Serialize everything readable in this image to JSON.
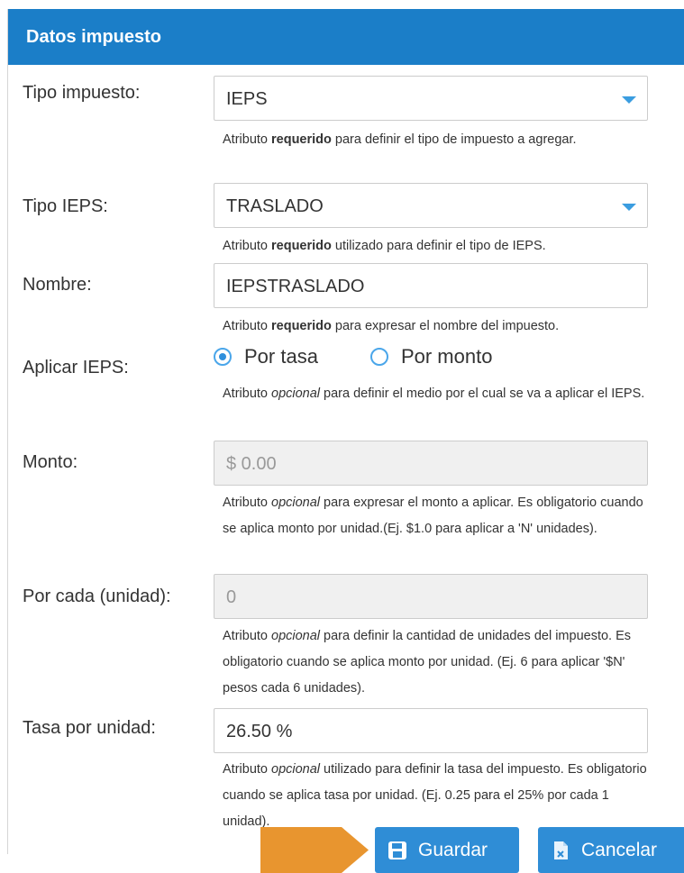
{
  "panel": {
    "title": "Datos impuesto"
  },
  "fields": {
    "tipo_impuesto": {
      "label": "Tipo impuesto:",
      "value": "IEPS",
      "help_pre": "Atributo ",
      "help_strong": "requerido",
      "help_post": " para definir el tipo de impuesto a agregar."
    },
    "tipo_ieps": {
      "label": "Tipo IEPS:",
      "value": "TRASLADO",
      "help_pre": "Atributo ",
      "help_strong": "requerido",
      "help_post": " utilizado para definir el tipo de IEPS."
    },
    "nombre": {
      "label": "Nombre:",
      "value": "IEPSTRASLADO",
      "help_pre": "Atributo ",
      "help_strong": "requerido",
      "help_post": " para expresar el nombre del impuesto."
    },
    "aplicar_ieps": {
      "label": "Aplicar IEPS:",
      "option1": "Por tasa",
      "option2": "Por monto",
      "selected": "Por tasa",
      "help_pre": "Atributo ",
      "help_em": "opcional",
      "help_post": " para definir el medio por el cual se va a aplicar el IEPS."
    },
    "monto": {
      "label": "Monto:",
      "placeholder": "$ 0.00",
      "help_pre": "Atributo ",
      "help_em": "opcional",
      "help_post": " para expresar el monto a aplicar. Es obligatorio cuando se aplica monto por unidad.(Ej. $1.0 para aplicar a 'N' unidades)."
    },
    "por_cada": {
      "label": "Por cada (unidad):",
      "placeholder": "0",
      "help_pre": "Atributo ",
      "help_em": "opcional",
      "help_post": " para definir la cantidad de unidades del impuesto. Es obligatorio cuando se aplica monto por unidad. (Ej. 6 para aplicar '$N' pesos cada 6 unidades)."
    },
    "tasa_por_unidad": {
      "label": "Tasa por unidad:",
      "value": "26.50 %",
      "help_pre": "Atributo ",
      "help_em": "opcional",
      "help_post": " utilizado para definir la tasa del impuesto. Es obligatorio cuando se aplica tasa por unidad. (Ej. 0.25 para el 25% por cada 1 unidad)."
    }
  },
  "buttons": {
    "save": "Guardar",
    "cancel": "Cancelar"
  },
  "colors": {
    "header": "#1b7ec8",
    "button": "#2f8dd6",
    "arrow": "#e8952f"
  }
}
